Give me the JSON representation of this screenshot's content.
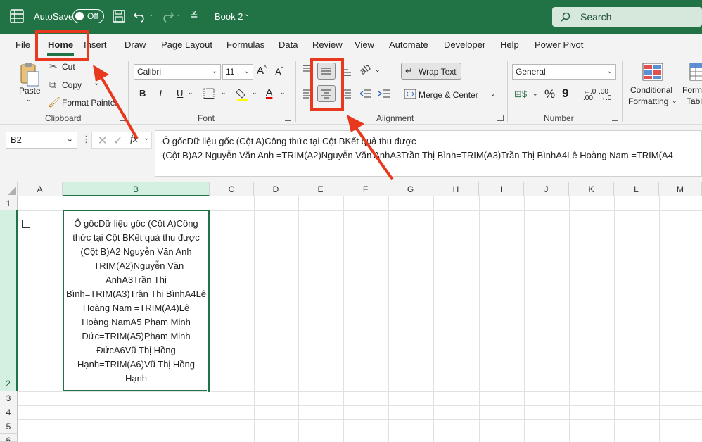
{
  "titlebar": {
    "autosave_label": "AutoSave",
    "autosave_state": "Off",
    "workbook_name": "Book 2",
    "search_placeholder": "Search"
  },
  "tabs": [
    "File",
    "Home",
    "Insert",
    "Draw",
    "Page Layout",
    "Formulas",
    "Data",
    "Review",
    "View",
    "Automate",
    "Developer",
    "Help",
    "Power Pivot"
  ],
  "ribbon": {
    "clipboard": {
      "paste": "Paste",
      "cut": "Cut",
      "copy": "Copy",
      "format_painter": "Format Painter",
      "label": "Clipboard"
    },
    "font": {
      "family": "Calibri",
      "size": "11",
      "bold": "B",
      "italic": "I",
      "underline": "U",
      "label": "Font"
    },
    "alignment": {
      "wrap_text": "Wrap Text",
      "merge_center": "Merge & Center",
      "label": "Alignment"
    },
    "number": {
      "format": "General",
      "label": "Number"
    },
    "styles": {
      "conditional_formatting_1": "Conditional",
      "conditional_formatting_2": "Formatting",
      "format_table_1": "Form",
      "format_table_2": "Tabl"
    }
  },
  "formula_bar": {
    "name_box": "B2",
    "fx": "fx",
    "line1": "Ô gốcDữ liệu gốc (Cột A)Công thức tại Cột BKết quả thu được",
    "line2": "(Cột B)A2 Nguyễn  Văn  Anh =TRIM(A2)Nguyễn Văn AnhA3Trần    Thị Bình=TRIM(A3)Trần Thị BìnhA4Lê Hoàng Nam     =TRIM(A4"
  },
  "grid": {
    "columns": [
      "A",
      "B",
      "C",
      "D",
      "E",
      "F",
      "G",
      "H",
      "I",
      "J",
      "K",
      "L",
      "M"
    ],
    "rows": [
      "1",
      "2",
      "3",
      "4",
      "5",
      "6"
    ],
    "b2_lines": [
      "Ô gốcDữ liệu gốc (Cột A)Công",
      "thức tại Cột BKết quả thu được",
      "(Cột B)A2 Nguyễn  Văn  Anh",
      "=TRIM(A2)Nguyễn Văn",
      "AnhA3Trần    Thị",
      "Bình=TRIM(A3)Trần Thị BìnhA4Lê",
      "Hoàng Nam     =TRIM(A4)Lê",
      "Hoàng NamA5   Phạm Minh",
      "Đức=TRIM(A5)Phạm Minh",
      "ĐứcA6Vũ   Thị   Hồng",
      "Hạnh=TRIM(A6)Vũ Thị Hồng",
      "Hạnh"
    ]
  },
  "colors": {
    "excel_green": "#217346",
    "annotation_red": "#e8391e",
    "selected_header": "#d3f0e0"
  }
}
